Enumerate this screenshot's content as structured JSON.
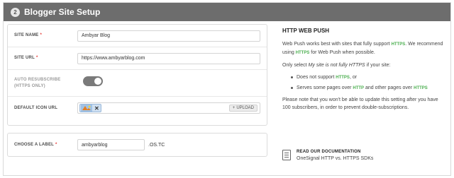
{
  "header": {
    "step": "2",
    "title": "Blogger Site Setup"
  },
  "form": {
    "site_name": {
      "label": "SITE NAME",
      "value": "Ambyar Blog"
    },
    "site_url": {
      "label": "SITE URL",
      "value": "https://www.ambyarblog.com"
    },
    "auto_resubscribe": {
      "label_line1": "AUTO RESUBSCRIBE",
      "label_line2": "(HTTPS ONLY)",
      "enabled": true
    },
    "default_icon": {
      "label": "DEFAULT ICON URL",
      "remove": "✕",
      "upload_label": "UPLOAD",
      "upload_icon": "+"
    },
    "choose_label": {
      "label": "CHOOSE A LABEL",
      "value": "ambyarblog",
      "suffix": ".OS.TC"
    },
    "required_mark": "*"
  },
  "info": {
    "title": "HTTP WEB PUSH",
    "p1_a": "Web Push works best with sites that fully support ",
    "p1_https": "HTTPS",
    "p1_b": ". We recommend using ",
    "p1_https2": "HTTPS",
    "p1_c": " for Web Push when possible.",
    "p2_a": "Only select ",
    "p2_em": "My site is not fully HTTPS",
    "p2_b": " if your site:",
    "bullet1_a": "Does not support ",
    "bullet1_https": "HTTPS",
    "bullet1_b": ", or",
    "bullet2_a": "Serves some pages over ",
    "bullet2_http": "HTTP",
    "bullet2_b": " and other pages over ",
    "bullet2_https": "HTTPS",
    "p3": "Please note that you won't be able to update this setting after you have 100 subscribers, in order to prevent double-subscriptions.",
    "doc_title": "READ OUR DOCUMENTATION",
    "doc_link": "OneSignal HTTP vs. HTTPS SDKs"
  },
  "colors": {
    "header_bg": "#6d6d6d",
    "https_green": "#4caf50",
    "required_red": "#e53935",
    "toggle_on": "#7a7a7a"
  }
}
